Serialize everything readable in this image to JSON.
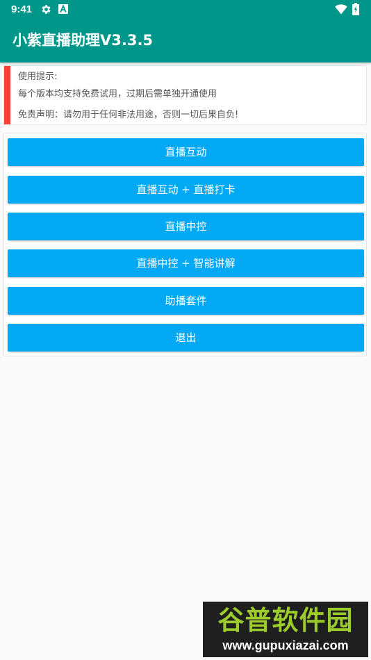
{
  "status_bar": {
    "time": "9:41",
    "icons": [
      "gear-icon",
      "a-letter-icon",
      "wifi-icon",
      "battery-icon"
    ]
  },
  "app_bar": {
    "title": "小紫直播助理V3.3.5"
  },
  "notice": {
    "title": "使用提示:",
    "line1": "每个版本均支持免费试用，过期后需单独开通使用",
    "line2": "免责声明：请勿用于任何非法用途，否则一切后果自负!"
  },
  "menu": {
    "buttons": [
      {
        "label": "直播互动"
      },
      {
        "label": "直播互动 + 直播打卡"
      },
      {
        "label": "直播中控"
      },
      {
        "label": "直播中控 + 智能讲解"
      },
      {
        "label": "助播套件"
      },
      {
        "label": "退出"
      }
    ]
  },
  "watermark": {
    "logo": "谷普软件园",
    "url": "www.gupuxiazai.com"
  },
  "colors": {
    "primary": "#00978a",
    "button": "#03a9f4",
    "notice_accent": "#f44336",
    "background": "#fafafa"
  }
}
